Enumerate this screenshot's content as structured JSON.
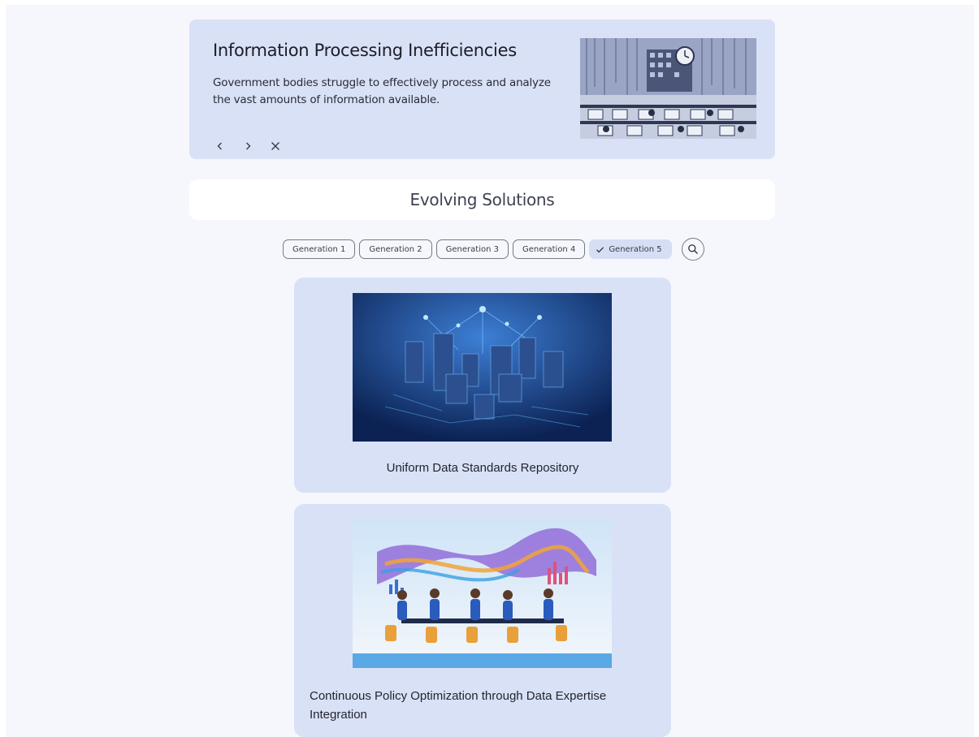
{
  "banner": {
    "title": "Information Processing Inefficiencies",
    "description": "Government bodies struggle to effectively process and analyze the vast amounts of information available.",
    "controls": {
      "prev": "‹",
      "next": "›",
      "close": "✕"
    },
    "image_alt": "office-clock-illustration"
  },
  "section": {
    "title": "Evolving Solutions"
  },
  "filters": {
    "chips": [
      {
        "label": "Generation 1",
        "selected": false
      },
      {
        "label": "Generation 2",
        "selected": false
      },
      {
        "label": "Generation 3",
        "selected": false
      },
      {
        "label": "Generation 4",
        "selected": false
      },
      {
        "label": "Generation 5",
        "selected": true
      }
    ],
    "check_icon": "check-icon",
    "search_icon": "search-icon"
  },
  "cards": [
    {
      "title": "Uniform Data Standards Repository",
      "image": "data-city-illustration"
    },
    {
      "title": "Continuous Policy Optimization through Data Expertise Integration",
      "image": "team-meeting-illustration"
    }
  ],
  "colors": {
    "page_bg": "#f6f7fd",
    "surface": "#d9e1f7",
    "chip_border": "#767a84",
    "selected_chip": "#d6def5"
  }
}
